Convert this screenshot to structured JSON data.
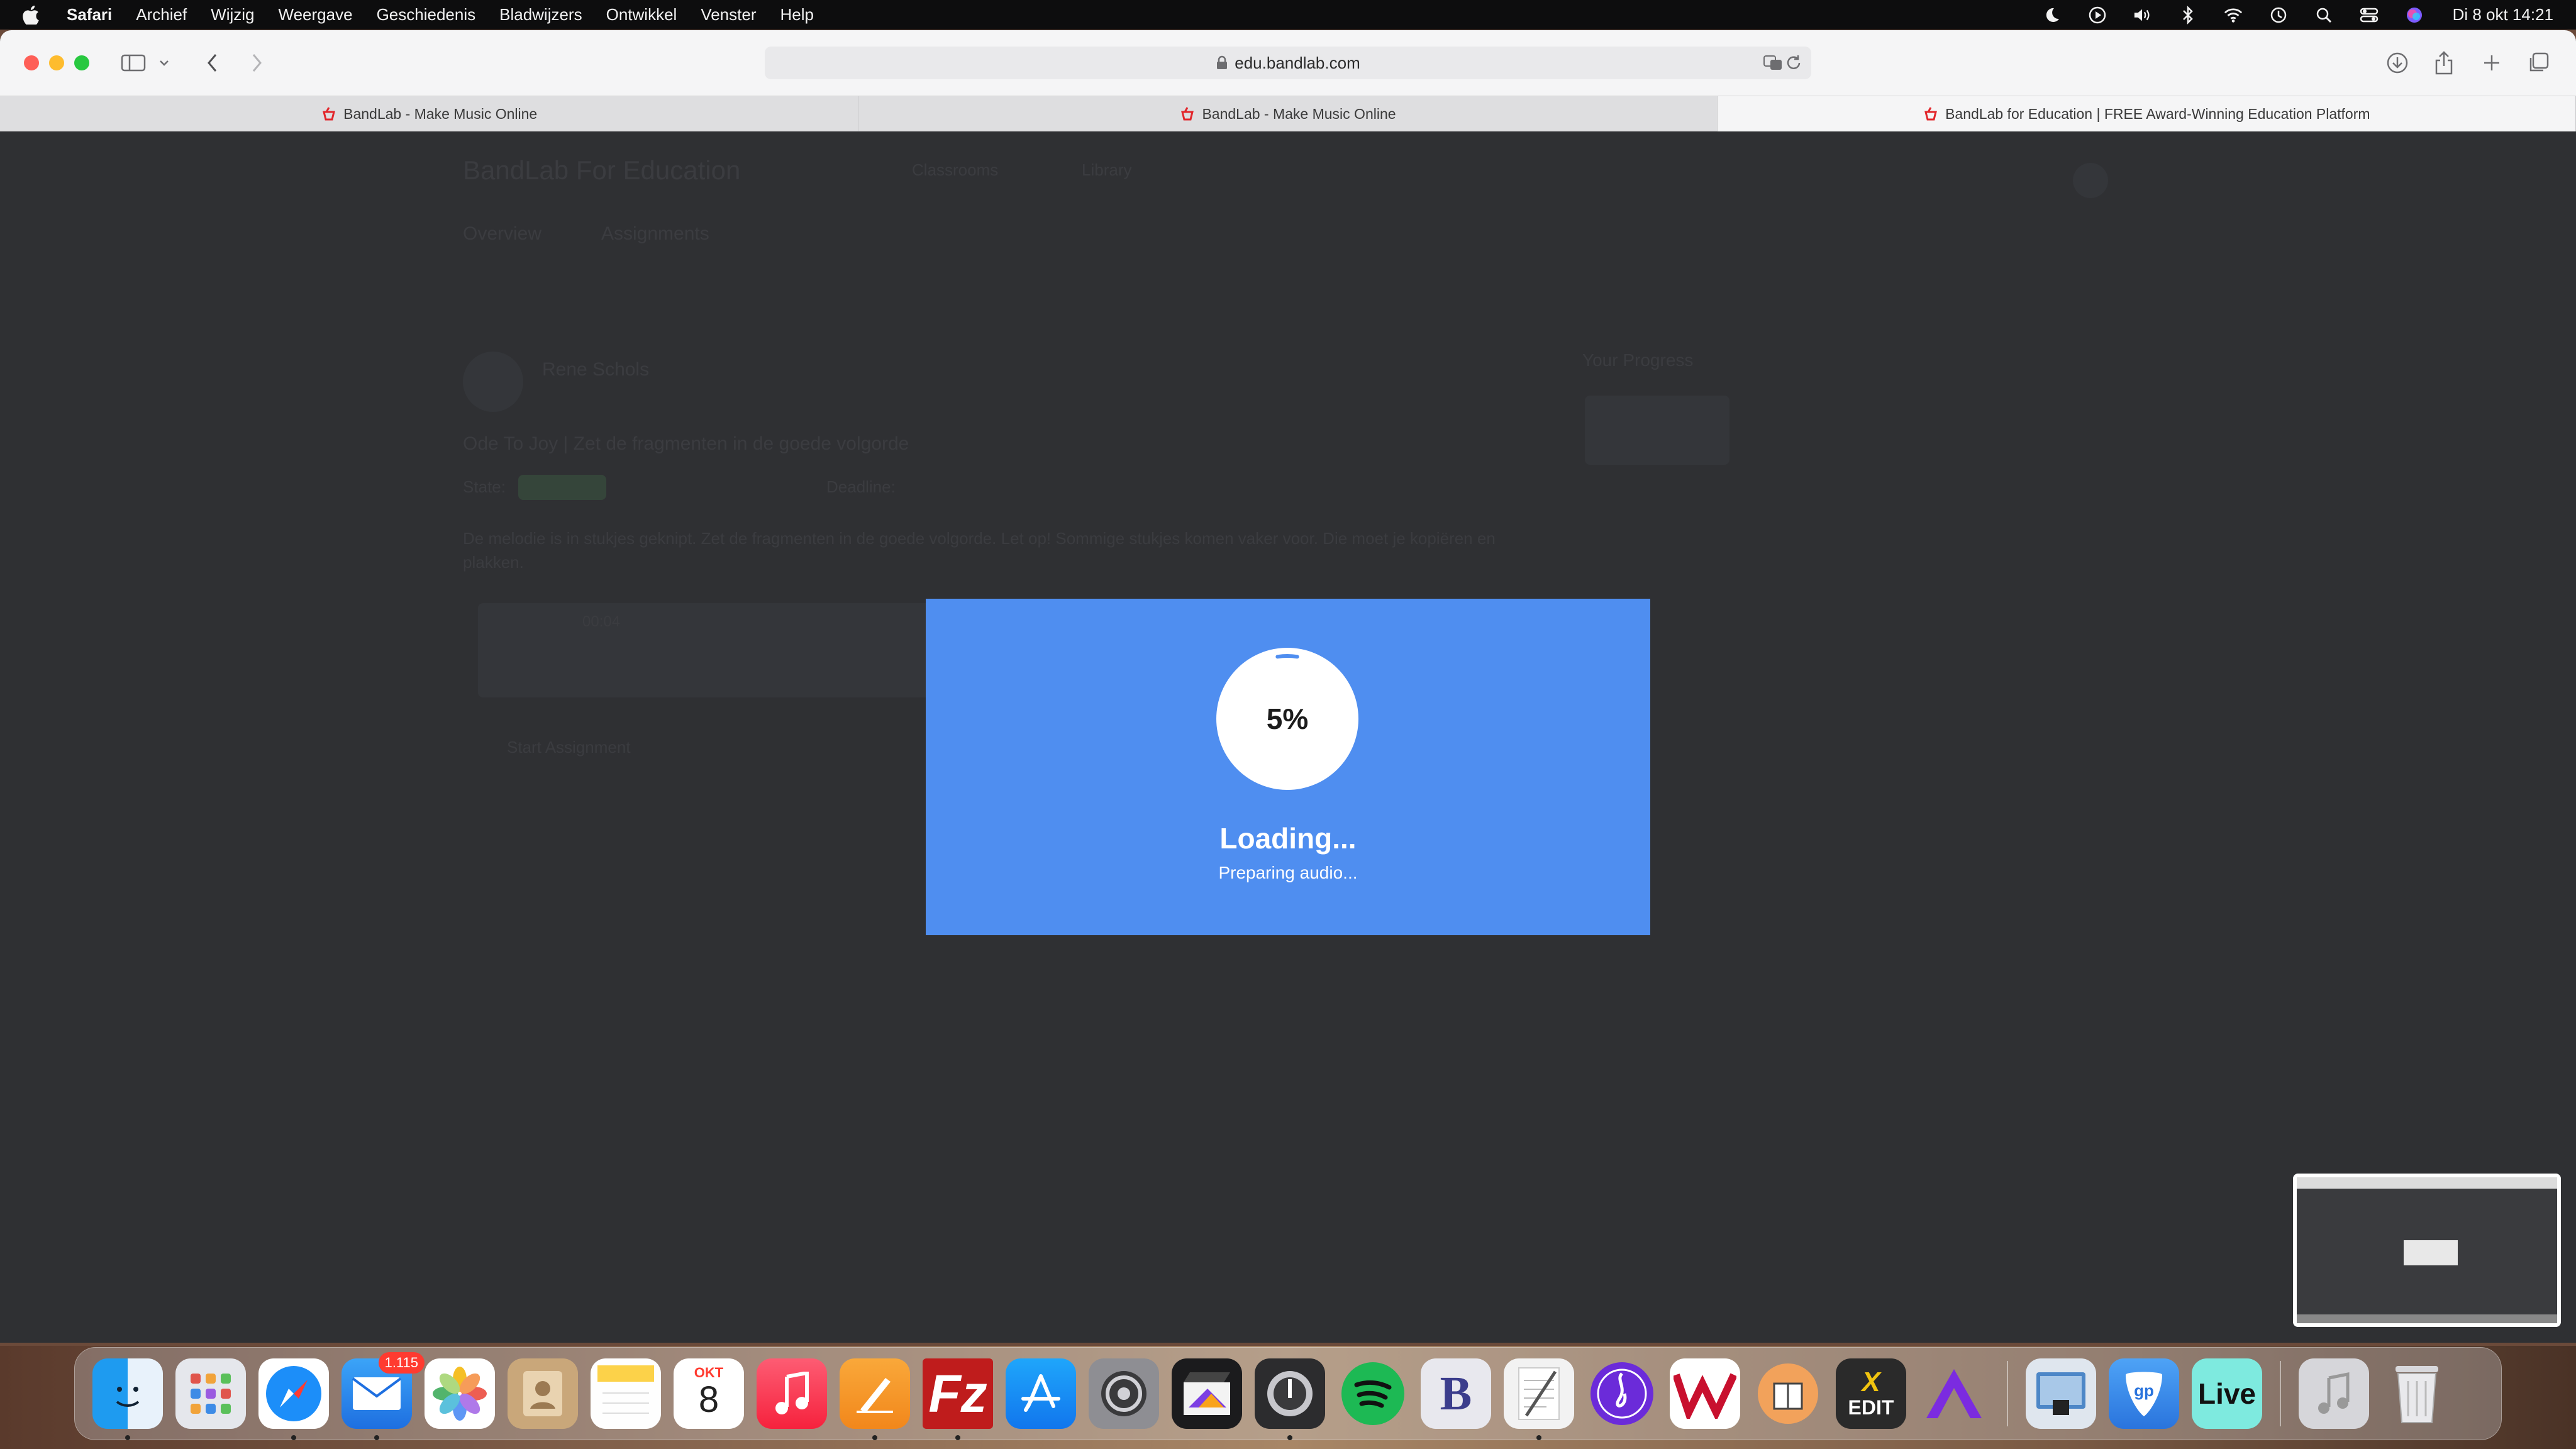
{
  "menubar": {
    "app_name": "Safari",
    "items": [
      "Archief",
      "Wijzig",
      "Weergave",
      "Geschiedenis",
      "Bladwijzers",
      "Ontwikkel",
      "Venster",
      "Help"
    ],
    "clock": "Di 8 okt  14:21"
  },
  "browser": {
    "url": "edu.bandlab.com",
    "tabs": [
      {
        "label": "BandLab - Make Music Online"
      },
      {
        "label": "BandLab - Make Music Online"
      },
      {
        "label": "BandLab for Education | FREE Award-Winning Education Platform"
      }
    ]
  },
  "page": {
    "logo": "BandLab For Education",
    "nav": [
      "Classrooms",
      "Library"
    ],
    "subnav": [
      "Overview",
      "Assignments"
    ],
    "author": "Rene Schols",
    "assignment_title": "Ode To Joy | Zet de fragmenten in de goede volgorde",
    "state_label": "State:",
    "deadline_label": "Deadline:",
    "description": "De melodie is in stukjes geknipt. Zet de fragmenten in de goede volgorde. Let op! Sommige stukjes komen vaker voor. Die moet je kopiëren en plakken.",
    "player_time": "00:04",
    "start_button": "Start Assignment",
    "progress_title": "Your Progress"
  },
  "loading": {
    "percent": "5%",
    "percent_value": 0.05,
    "title": "Loading...",
    "subtitle": "Preparing audio..."
  },
  "dock": {
    "mail_badge": "1.115",
    "calendar_month": "OKT",
    "calendar_day": "8",
    "live_label": "Live",
    "edit_label": "EDIT",
    "items": [
      "finder-icon",
      "launchpad-icon",
      "safari-icon",
      "mail-icon",
      "photos-icon",
      "contacts-icon",
      "notes-icon",
      "calendar-icon",
      "music-icon",
      "pages-icon",
      "filezilla-icon",
      "app-store-icon",
      "system-settings-icon",
      "final-cut-icon",
      "logic-icon",
      "spotify-icon",
      "bbedit-icon",
      "textedit-icon",
      "notation-icon",
      "wavelab-icon",
      "dictionary-icon",
      "x32-edit-icon",
      "avid-icon",
      "preview-icon",
      "guitar-pro-icon",
      "live-icon",
      "music-folder-icon",
      "trash-icon"
    ]
  }
}
